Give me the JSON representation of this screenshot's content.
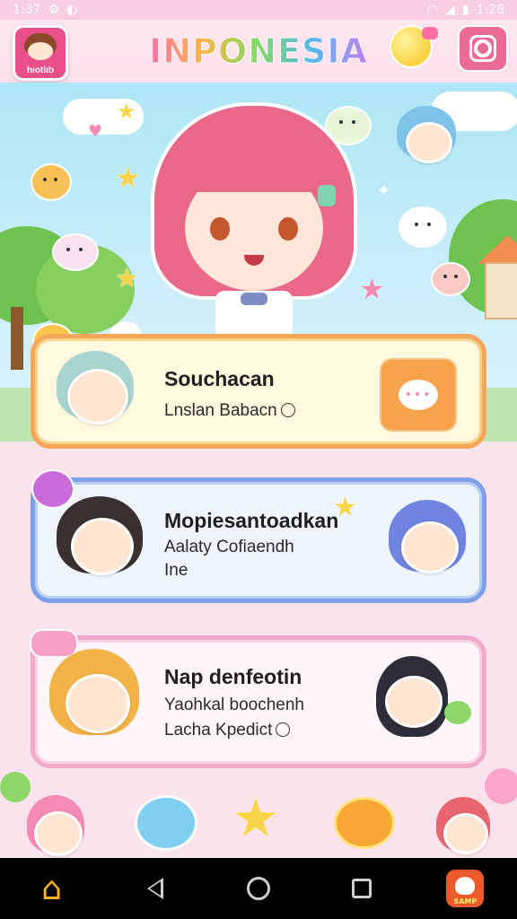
{
  "status_bar": {
    "time_left": "1:37",
    "time_right": "1:28"
  },
  "header": {
    "app_avatar_label": "hıotlıb",
    "title": "INPONESIA",
    "avatar_color": "#e94f88",
    "camera_color": "#ec6a98"
  },
  "icons": {
    "wifi": "wifi-icon",
    "signal": "signal-icon",
    "battery": "battery-icon",
    "balloon": "balloon-icon",
    "camera": "camera-icon",
    "chat": "chat-bubble-icon",
    "clock": "clock-icon",
    "home": "home-icon",
    "back": "back-icon",
    "circle": "home-circle-icon",
    "square": "recents-icon",
    "skull": "skull-icon"
  },
  "cards": [
    {
      "title": "Souchacan",
      "lines": [
        "Lnslan Babacn"
      ],
      "has_clock": true,
      "accent": "#f6a65a"
    },
    {
      "title": "Mopiesantoadkan",
      "lines": [
        "Aalaty Cofiaendh",
        "Ine"
      ],
      "has_clock": false,
      "accent": "#7ea0e6"
    },
    {
      "title": "Nap denfeotin",
      "lines": [
        "Yaohkal boochenh",
        "Lacha Kpedict"
      ],
      "has_clock": true,
      "accent": "#f2a8c9"
    }
  ],
  "nav_bar": {
    "home_color": "#f7b321",
    "skull_label": "SAMP"
  }
}
